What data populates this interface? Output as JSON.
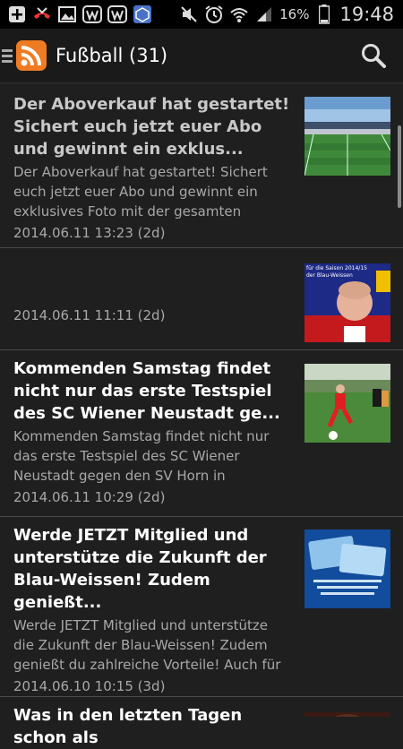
{
  "status_bar": {
    "battery": "16%",
    "time": "19:48"
  },
  "action_bar": {
    "title": "Fußball (31)"
  },
  "items": [
    {
      "title": "Der Aboverkauf hat gestartet! Sichert euch jetzt euer Abo und gewinnt ein exklus...",
      "summary": "Der Aboverkauf hat gestartet! Sichert euch jetzt euer Abo und gewinnt ein exklusives Foto mit der gesamten",
      "date": "2014.06.11 13:23 (2d)",
      "read": true,
      "thumb": "stadium"
    },
    {
      "title": "",
      "summary": "",
      "date": "2014.06.11 11:11 (2d)",
      "read": false,
      "thumb": "player-portrait",
      "thumb_text": "für die Saison 2014/15 der Blau-Weissen"
    },
    {
      "title": "Kommenden Samstag findet nicht nur das erste Testspiel des SC Wiener Neustadt ge...",
      "summary": "Kommenden Samstag findet nicht nur das erste Testspiel des SC Wiener Neustadt gegen den SV Horn in",
      "date": "2014.06.11 10:29 (2d)",
      "read": false,
      "thumb": "match-action"
    },
    {
      "title": "Werde JETZT Mitglied und unterstütze die Zukunft der Blau-Weissen! Zudem genießt...",
      "summary": "Werde JETZT Mitglied und unterstütze die Zukunft der Blau-Weissen! Zudem genießt du zahlreiche Vorteile! Auch für",
      "date": "2014.06.10 10:15 (3d)",
      "read": false,
      "thumb": "membership-cards"
    },
    {
      "title": "Was in den letzten Tagen schon als",
      "summary": "",
      "date": "",
      "read": false,
      "thumb": "portrait"
    }
  ]
}
